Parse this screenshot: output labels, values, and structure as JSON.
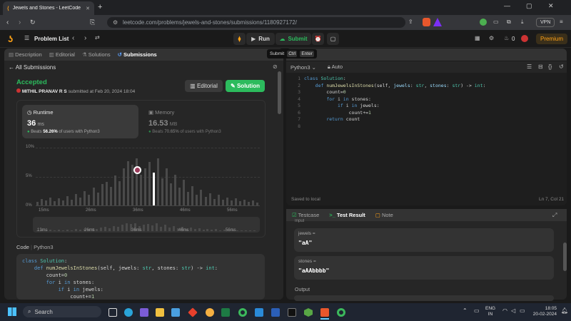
{
  "browser": {
    "tab_title": "Jewels and Stones - LeetCode",
    "url": "leetcode.com/problems/jewels-and-stones/submissions/1180927172/",
    "vpn_label": "VPN"
  },
  "lc_nav": {
    "problem_list": "Problem List",
    "run": "Run",
    "submit": "Submit",
    "coins": "0",
    "premium": "Premium"
  },
  "tooltip": {
    "label": "Submit",
    "keys": [
      "Ctrl",
      "Enter"
    ]
  },
  "left_tabs": [
    "Description",
    "Editorial",
    "Solutions",
    "Submissions"
  ],
  "all_submissions": "All Submissions",
  "result": {
    "status": "Accepted",
    "user": "MITHIL PRANAV R S",
    "submitted": "submitted at Feb 20, 2024 18:04",
    "editorial_btn": "Editorial",
    "solution_btn": "Solution"
  },
  "runtime": {
    "label": "Runtime",
    "value": "36",
    "unit": "ms",
    "beats_prefix": "Beats",
    "beats_pct": "56.26%",
    "beats_suffix": "of users with Python3"
  },
  "memory": {
    "label": "Memory",
    "value": "16.53",
    "unit": "MB",
    "beats_prefix": "Beats",
    "beats_pct": "70.65%",
    "beats_suffix": "of users with Python3"
  },
  "histogram": {
    "y_ticks": [
      "10%",
      "5%",
      "0%"
    ],
    "x_ticks": [
      "15ms",
      "26ms",
      "36ms",
      "46ms",
      "56ms"
    ],
    "mini_ticks": [
      "13ms",
      "26ms",
      "36ms",
      "46ms",
      "56ms"
    ],
    "values": [
      0.6,
      1.1,
      0.8,
      1.4,
      0.7,
      1.2,
      0.9,
      1.6,
      1.0,
      2.0,
      1.3,
      2.5,
      1.8,
      3.1,
      2.2,
      3.6,
      4.0,
      3.2,
      5.1,
      4.2,
      6.3,
      7.6,
      6.9,
      8.0,
      5.3,
      6.4,
      7.4,
      5.6,
      8.1,
      4.6,
      6.3,
      3.8,
      5.3,
      3.1,
      4.4,
      2.3,
      3.3,
      1.8,
      2.7,
      1.5,
      2.1,
      1.1,
      1.8,
      1.0,
      1.4,
      0.8,
      1.2,
      0.7,
      1.0,
      0.6,
      0.9,
      0.5
    ],
    "highlight_index": 27
  },
  "code_section": {
    "label": "Code",
    "lang": "Python3"
  },
  "editor": {
    "lang": "Python3",
    "mode": "Auto",
    "saved": "Saved to local",
    "cursor": "Ln 7, Col 21",
    "line_numbers": [
      "1",
      "2",
      "3",
      "4",
      "5",
      "6",
      "7",
      "8"
    ],
    "lines": [
      [
        [
          "kw",
          "class "
        ],
        [
          "ty",
          "Solution"
        ],
        [
          "tx",
          ":"
        ]
      ],
      [
        [
          "tx",
          "    "
        ],
        [
          "kw",
          "def "
        ],
        [
          "fn",
          "numJewelsInStones"
        ],
        [
          "tx",
          "(self, "
        ],
        [
          "pl",
          "jewels"
        ],
        [
          "tx",
          ": "
        ],
        [
          "ty",
          "str"
        ],
        [
          "tx",
          ", "
        ],
        [
          "pl",
          "stones"
        ],
        [
          "tx",
          ": "
        ],
        [
          "ty",
          "str"
        ],
        [
          "tx",
          ") -> "
        ],
        [
          "ty",
          "int"
        ],
        [
          "tx",
          ":"
        ]
      ],
      [
        [
          "tx",
          "        count"
        ],
        [
          "tx",
          "="
        ],
        [
          "num",
          "0"
        ]
      ],
      [
        [
          "tx",
          "        "
        ],
        [
          "kw",
          "for "
        ],
        [
          "tx",
          "i "
        ],
        [
          "kw",
          "in "
        ],
        [
          "tx",
          "stones:"
        ]
      ],
      [
        [
          "tx",
          "            "
        ],
        [
          "kw",
          "if "
        ],
        [
          "tx",
          "i "
        ],
        [
          "kw",
          "in "
        ],
        [
          "tx",
          "jewels:"
        ]
      ],
      [
        [
          "tx",
          "                count"
        ],
        [
          "tx",
          "+="
        ],
        [
          "num",
          "1"
        ]
      ],
      [
        [
          "tx",
          "        "
        ],
        [
          "kw",
          "return "
        ],
        [
          "tx",
          "count"
        ]
      ],
      [
        [
          "tx",
          ""
        ]
      ]
    ]
  },
  "left_code_lines": [
    [
      [
        "kw",
        "class "
      ],
      [
        "ty",
        "Solution"
      ],
      [
        "tx",
        ":"
      ]
    ],
    [
      [
        "tx",
        "    "
      ],
      [
        "kw",
        "def "
      ],
      [
        "fn",
        "numJewelsInStones"
      ],
      [
        "tx",
        "(self, jewels: "
      ],
      [
        "ty",
        "str"
      ],
      [
        "tx",
        ", stones: "
      ],
      [
        "ty",
        "str"
      ],
      [
        "tx",
        ") -> "
      ],
      [
        "ty",
        "int"
      ],
      [
        "tx",
        ":"
      ]
    ],
    [
      [
        "tx",
        "        count"
      ],
      [
        "tx",
        "="
      ],
      [
        "num",
        "0"
      ]
    ],
    [
      [
        "tx",
        "        "
      ],
      [
        "kw",
        "for "
      ],
      [
        "tx",
        "i "
      ],
      [
        "kw",
        "in "
      ],
      [
        "tx",
        "stones:"
      ]
    ],
    [
      [
        "tx",
        "            "
      ],
      [
        "kw",
        "if "
      ],
      [
        "tx",
        "i "
      ],
      [
        "kw",
        "in "
      ],
      [
        "tx",
        "jewels:"
      ]
    ],
    [
      [
        "tx",
        "                count"
      ],
      [
        "tx",
        "+="
      ],
      [
        "num",
        "1"
      ]
    ]
  ],
  "test": {
    "tabs": [
      "Testcase",
      "Test Result",
      "Note"
    ],
    "input_label": "Input",
    "jewels_label": "jewels =",
    "jewels_value": "\"aA\"",
    "stones_label": "stones =",
    "stones_value": "\"aAAbbbb\"",
    "output_label": "Output"
  },
  "taskbar": {
    "search": "Search",
    "lang1": "ENG",
    "lang2": "IN",
    "time": "18:05",
    "date": "20-02-2024"
  }
}
